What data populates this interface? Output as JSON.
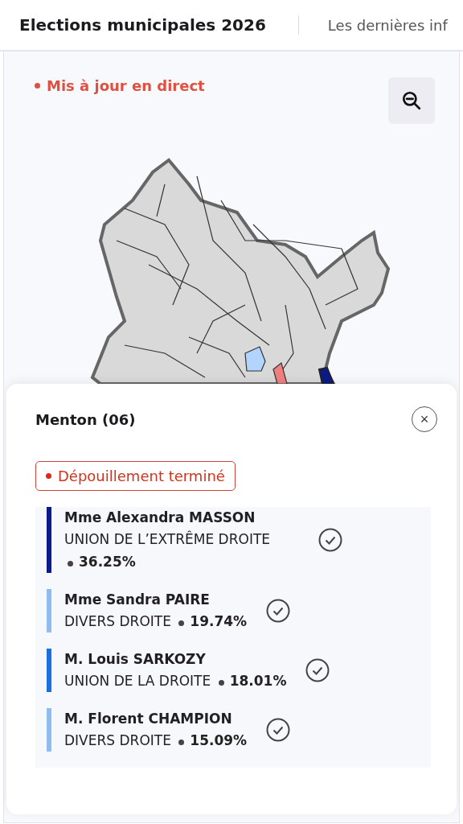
{
  "nav": [
    {
      "label": "Elections municipales 2026",
      "selected": true
    },
    {
      "label": "Les dernières inf",
      "selected": false
    }
  ],
  "map": {
    "live_label": "Mis à jour en direct"
  },
  "panel": {
    "title": "Menton (06)",
    "close": "×",
    "status": "Dépouillement terminé",
    "candidates": [
      {
        "name": "Mme Alexandra MASSON",
        "party": "UNION DE L’EXTRÊME DROITE",
        "percent": "36.25%",
        "color": "#0a1a8c",
        "checked": true
      },
      {
        "name": "Mme Sandra PAIRE",
        "party": "DIVERS DROITE",
        "percent": "19.74%",
        "color": "#8fbcf0",
        "checked": true
      },
      {
        "name": "M. Louis SARKOZY",
        "party": "UNION DE LA DROITE",
        "percent": "18.01%",
        "color": "#1a6fe0",
        "checked": true
      },
      {
        "name": "M. Florent CHAMPION",
        "party": "DIVERS DROITE",
        "percent": "15.09%",
        "color": "#8fbcf0",
        "checked": true
      }
    ]
  }
}
